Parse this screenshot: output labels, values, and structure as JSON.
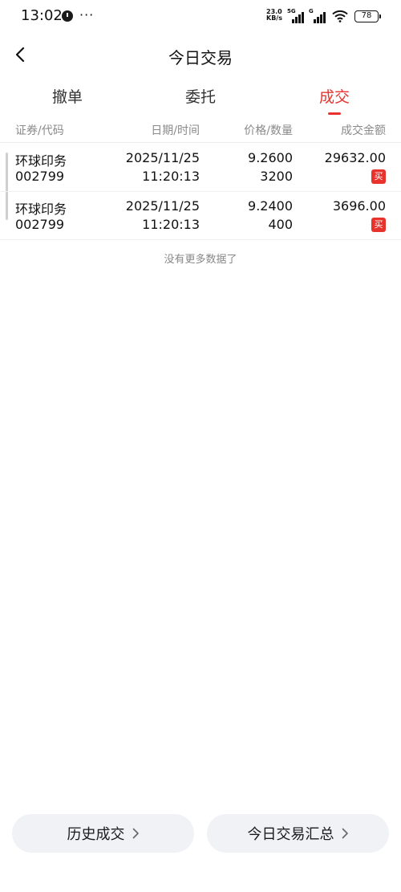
{
  "status_bar": {
    "time": "13:02",
    "more": "···",
    "net_speed_value": "23.0",
    "net_speed_unit": "KB/s",
    "signal1_tech": "5G",
    "signal2_tech": "G",
    "battery": "78"
  },
  "header": {
    "title": "今日交易"
  },
  "tabs": [
    {
      "label": "撤单"
    },
    {
      "label": "委托"
    },
    {
      "label": "成交",
      "active": true
    }
  ],
  "table": {
    "headers": {
      "security": "证券/代码",
      "datetime": "日期/时间",
      "price_qty": "价格/数量",
      "amount": "成交金额"
    },
    "rows": [
      {
        "name": "环球印务",
        "code": "002799",
        "date": "2025/11/25",
        "time": "11:20:13",
        "price": "9.2600",
        "qty": "3200",
        "amount": "29632.00",
        "side": "买"
      },
      {
        "name": "环球印务",
        "code": "002799",
        "date": "2025/11/25",
        "time": "11:20:13",
        "price": "9.2400",
        "qty": "400",
        "amount": "3696.00",
        "side": "买"
      }
    ]
  },
  "footer_text": "没有更多数据了",
  "buttons": {
    "history": "历史成交",
    "summary": "今日交易汇总"
  },
  "colors": {
    "accent": "#e8332d",
    "button_bg": "#f1f2f6",
    "muted_text": "#8a8a8a"
  }
}
